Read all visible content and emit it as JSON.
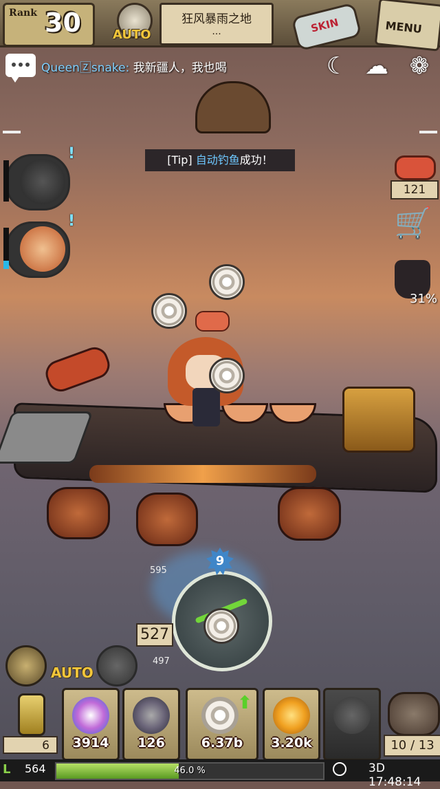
{
  "top_bar": {
    "rank_label": "Rank",
    "rank_value": "30",
    "auto_label": "AUTO",
    "location_title": "狂风暴雨之地",
    "location_sub": "...",
    "skin_label": "SKIN",
    "menu_label": "MENU"
  },
  "chat": {
    "sender": "Queen🅉snake",
    "separator": ":",
    "message": "我新疆人，我也喝"
  },
  "top_right_icons": [
    "moon-icon",
    "cloud-upload-icon",
    "cloud-icon"
  ],
  "tip": {
    "prefix": "[Tip] ",
    "highlight": "自动钓鱼",
    "suffix": "成功！"
  },
  "right_panel": {
    "meat_count": "121",
    "progress_pct": "31%"
  },
  "fishing_gauge": {
    "level": "9",
    "depth_top": "595",
    "depth_current": "527",
    "depth_bottom": "497"
  },
  "bottom_skills": {
    "auto_label": "AUTO"
  },
  "inventory": {
    "left_count": "6",
    "items": [
      {
        "name": "pearl",
        "value": "3914",
        "color": "#c06ad8"
      },
      {
        "name": "web-stone",
        "value": "126",
        "color": "#6a6478"
      },
      {
        "name": "shell",
        "value": "6.37b",
        "color": "#eae4da"
      },
      {
        "name": "gold-ore",
        "value": "3.20k",
        "color": "#f0a020"
      }
    ],
    "bag_count": "10 / 13"
  },
  "status_bar": {
    "level": "564",
    "exp_percent": "46.0 %",
    "exp_fraction": 0.46,
    "clock": "3D 17:48:14"
  }
}
